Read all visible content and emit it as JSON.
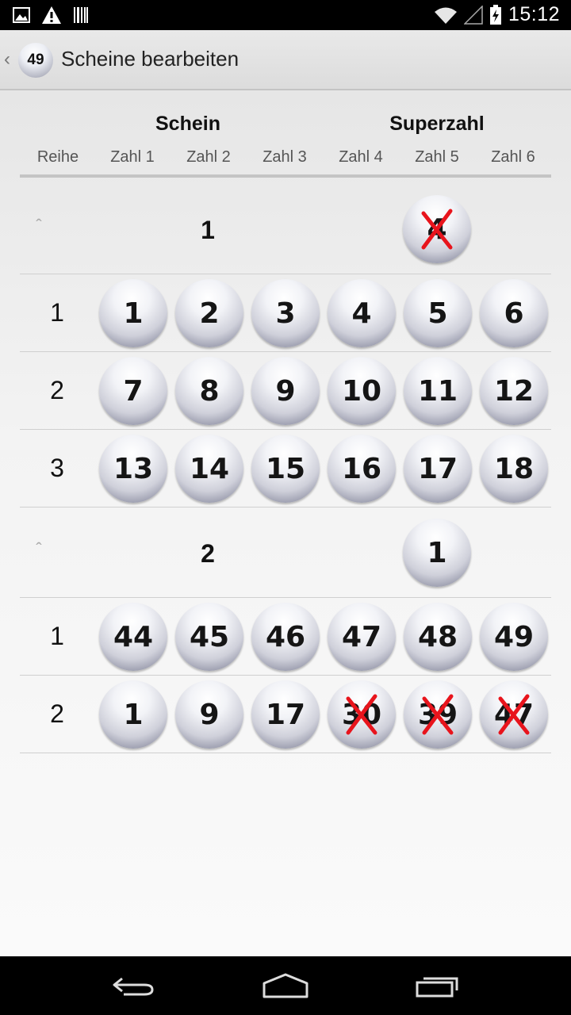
{
  "status_bar": {
    "time": "15:12",
    "left_icons": [
      "image-icon",
      "warning-icon",
      "barcode-icon"
    ],
    "right_icons": [
      "wifi-icon",
      "signal-icon",
      "battery-charging-icon"
    ]
  },
  "action_bar": {
    "app_icon_label": "49",
    "title": "Scheine bearbeiten"
  },
  "table_header": {
    "group_schein": "Schein",
    "group_superzahl": "Superzahl",
    "columns": [
      "Reihe",
      "Zahl 1",
      "Zahl 2",
      "Zahl 3",
      "Zahl 4",
      "Zahl 5",
      "Zahl 6"
    ]
  },
  "tickets": [
    {
      "number": "1",
      "superzahl": "4",
      "superzahl_crossed": true,
      "rows": [
        {
          "reihe": "1",
          "numbers": [
            "1",
            "2",
            "3",
            "4",
            "5",
            "6"
          ],
          "crossed": [
            false,
            false,
            false,
            false,
            false,
            false
          ]
        },
        {
          "reihe": "2",
          "numbers": [
            "7",
            "8",
            "9",
            "10",
            "11",
            "12"
          ],
          "crossed": [
            false,
            false,
            false,
            false,
            false,
            false
          ]
        },
        {
          "reihe": "3",
          "numbers": [
            "13",
            "14",
            "15",
            "16",
            "17",
            "18"
          ],
          "crossed": [
            false,
            false,
            false,
            false,
            false,
            false
          ]
        }
      ]
    },
    {
      "number": "2",
      "superzahl": "1",
      "superzahl_crossed": false,
      "rows": [
        {
          "reihe": "1",
          "numbers": [
            "44",
            "45",
            "46",
            "47",
            "48",
            "49"
          ],
          "crossed": [
            false,
            false,
            false,
            false,
            false,
            false
          ]
        },
        {
          "reihe": "2",
          "numbers": [
            "1",
            "9",
            "17",
            "30",
            "39",
            "47"
          ],
          "crossed": [
            false,
            false,
            false,
            true,
            true,
            true
          ]
        }
      ]
    }
  ],
  "colors": {
    "cross": "#e8141c",
    "action_bar": "#e2e2e2",
    "divider": "#cfcfcf"
  },
  "nav_bar": {
    "icons": [
      "back-icon",
      "home-icon",
      "recent-apps-icon"
    ]
  }
}
